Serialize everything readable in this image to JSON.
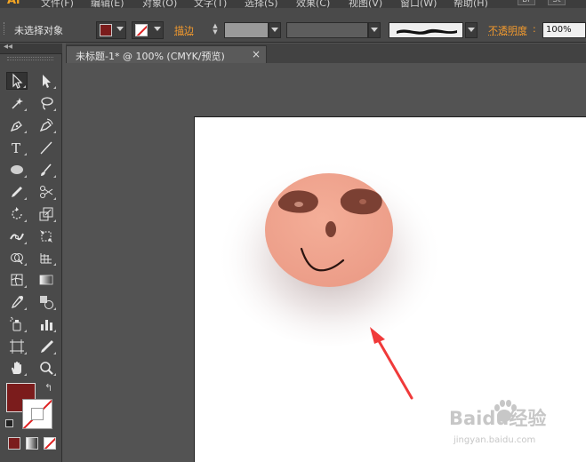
{
  "app": {
    "logo": "Ai"
  },
  "menu": {
    "items": [
      "文件(F)",
      "编辑(E)",
      "对象(O)",
      "文字(T)",
      "选择(S)",
      "效果(C)",
      "视图(V)",
      "窗口(W)",
      "帮助(H)"
    ],
    "buttons": [
      "Br",
      "St"
    ]
  },
  "controlbar": {
    "selection_label": "未选择对象",
    "stroke_label": "描边",
    "opacity_label": "不透明度",
    "opacity_value": "100%"
  },
  "document_tab": {
    "title": "未标题-1* @ 100% (CMYK/预览)",
    "close": "×"
  },
  "toolbox": {
    "collapse": "◂◂",
    "tools": [
      "selection-tool",
      "direct-selection-tool",
      "magic-wand-tool",
      "lasso-tool",
      "pen-tool",
      "curvature-tool",
      "type-tool",
      "line-segment-tool",
      "ellipse-tool",
      "paintbrush-tool",
      "pencil-tool",
      "scissors-tool",
      "rotate-tool",
      "scale-tool",
      "width-tool",
      "free-transform-tool",
      "shape-builder-tool",
      "perspective-grid-tool",
      "mesh-tool",
      "gradient-tool",
      "eyedropper-tool",
      "blend-tool",
      "symbol-sprayer-tool",
      "column-graph-tool",
      "artboard-tool",
      "slice-tool",
      "hand-tool",
      "zoom-tool"
    ],
    "swap_glyph": "↰"
  },
  "colors": {
    "fill": "#7b1c1c",
    "stroke_none_slash": "#e02020",
    "face": "#f0a48f",
    "eyes": "#7b4033",
    "mouth": "#2a1410",
    "arrow": "#f03a3a",
    "ui_accent": "#f29a2e"
  },
  "watermark": {
    "text": "Baidu经验",
    "sub": "jingyan.baidu.com"
  }
}
